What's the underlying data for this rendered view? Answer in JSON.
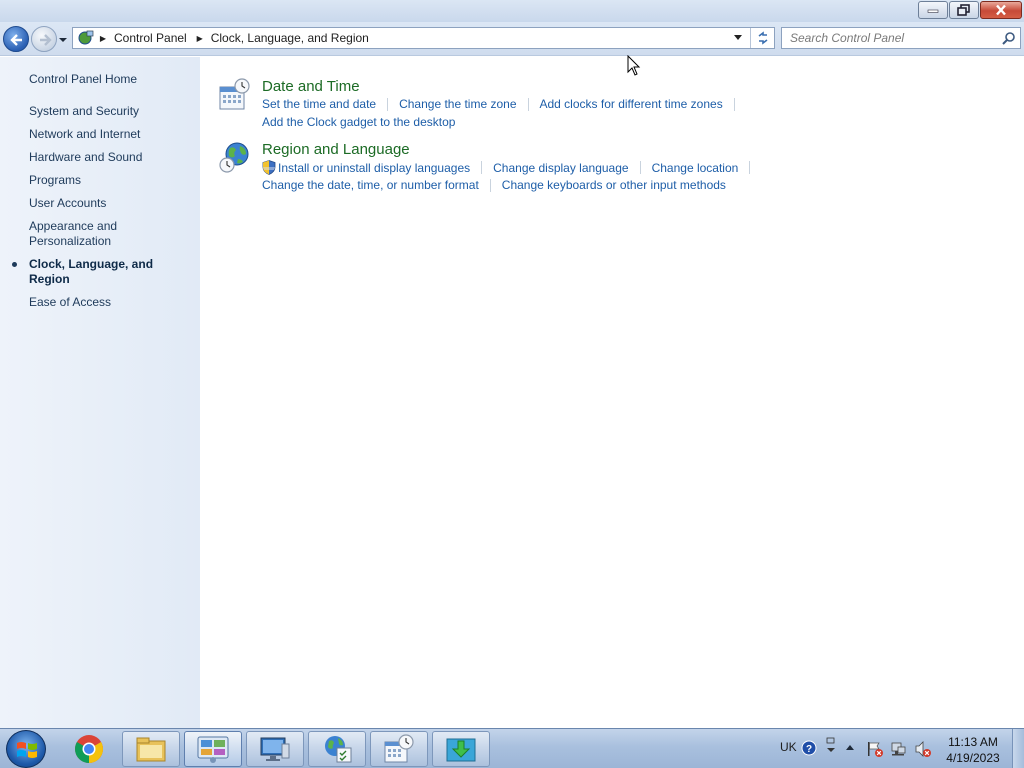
{
  "address": {
    "crumbs": [
      "Control Panel",
      "Clock, Language, and Region"
    ]
  },
  "search": {
    "placeholder": "Search Control Panel"
  },
  "left_pane": {
    "home": "Control Panel Home",
    "items": [
      {
        "label": "System and Security"
      },
      {
        "label": "Network and Internet"
      },
      {
        "label": "Hardware and Sound"
      },
      {
        "label": "Programs"
      },
      {
        "label": "User Accounts"
      },
      {
        "label": "Appearance and Personalization"
      },
      {
        "label": "Clock, Language, and Region",
        "active": true
      },
      {
        "label": "Ease of Access"
      }
    ]
  },
  "categories": [
    {
      "title": "Date and Time",
      "icon": "calendar-clock-icon",
      "links_row1": [
        "Set the time and date",
        "Change the time zone",
        "Add clocks for different time zones"
      ],
      "links_row2": [
        "Add the Clock gadget to the desktop"
      ]
    },
    {
      "title": "Region and Language",
      "icon": "globe-clock-icon",
      "links_row1": [
        "Install or uninstall display languages",
        "Change display language",
        "Change location"
      ],
      "links_row2": [
        "Change the date, time, or number format",
        "Change keyboards or other input methods"
      ]
    }
  ],
  "taskbar": {
    "language": "UK",
    "time": "11:13 AM",
    "date": "4/19/2023",
    "apps": [
      "chrome-icon",
      "file-explorer-icon",
      "control-panel-icon",
      "computer-management-icon",
      "region-language-icon",
      "date-time-icon",
      "download-icon"
    ]
  },
  "colors": {
    "category_title": "#1c6b25",
    "link": "#1e5ea8",
    "left_pane_bg": "#e8eff8"
  }
}
